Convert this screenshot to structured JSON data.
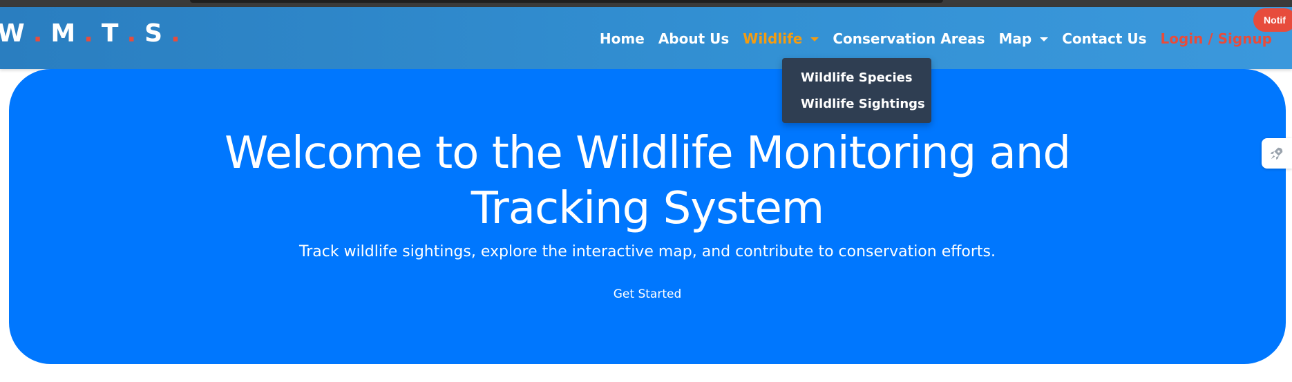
{
  "brand": {
    "letters": [
      "W",
      "M",
      "T",
      "S"
    ],
    "dot": "."
  },
  "nav": {
    "home": "Home",
    "about": "About Us",
    "wildlife": "Wildlife",
    "conservation": "Conservation Areas",
    "map": "Map",
    "contact": "Contact Us",
    "login": "Login / Signup",
    "notif_badge": "Notif"
  },
  "dropdown": {
    "items": [
      "Wildlife Species",
      "Wildlife Sightings"
    ]
  },
  "hero": {
    "title_line1": "Welcome to the Wildlife Monitoring and",
    "title_line2": "Tracking System",
    "subtitle": "Track wildlife sightings, explore the interactive map, and contribute to conservation efforts.",
    "cta": "Get Started"
  },
  "icons": {
    "side_tab": "rocket-icon"
  },
  "colors": {
    "navbar": "#2f8ad0",
    "hero": "#0077fe",
    "active_link": "#f39c12",
    "accent_red": "#e74c3c",
    "dropdown": "#2f3e52"
  }
}
